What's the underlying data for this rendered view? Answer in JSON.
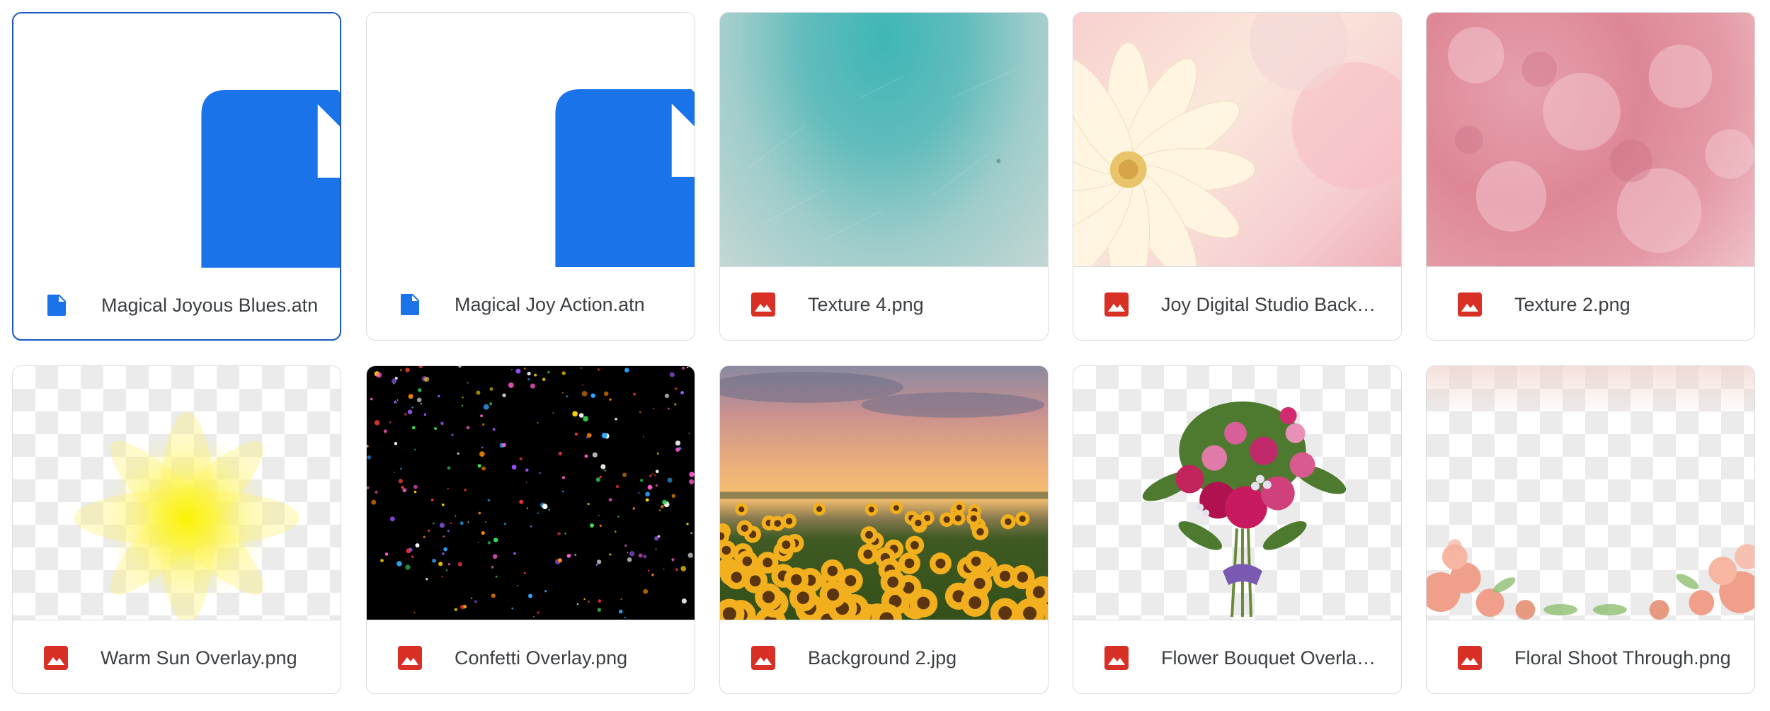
{
  "files": [
    {
      "name": "Magical Joyous Blues.atn",
      "type": "document",
      "icon": "document-icon",
      "selected": true
    },
    {
      "name": "Magical Joy Action.atn",
      "type": "document",
      "icon": "document-icon",
      "selected": false
    },
    {
      "name": "Texture 4.png",
      "type": "image",
      "icon": "image-icon",
      "preview": "teal-texture"
    },
    {
      "name": "Joy Digital Studio Backdrop.png",
      "type": "image",
      "icon": "image-icon",
      "preview": "cream-flower"
    },
    {
      "name": "Texture 2.png",
      "type": "image",
      "icon": "image-icon",
      "preview": "pink-texture"
    },
    {
      "name": "Warm Sun Overlay.png",
      "type": "image",
      "icon": "image-icon",
      "preview": "yellow-sun-overlay"
    },
    {
      "name": "Confetti Overlay.png",
      "type": "image",
      "icon": "image-icon",
      "preview": "confetti-on-black"
    },
    {
      "name": "Background 2.jpg",
      "type": "image",
      "icon": "image-icon",
      "preview": "sunflower-field-sunset"
    },
    {
      "name": "Flower Bouquet Overlay.png",
      "type": "image",
      "icon": "image-icon",
      "preview": "flower-bouquet"
    },
    {
      "name": "Floral Shoot Through.png",
      "type": "image",
      "icon": "image-icon",
      "preview": "floral-border"
    }
  ],
  "colors": {
    "doc_icon": "#1a73e8",
    "image_icon": "#d93025",
    "selected_border": "#1a56c4",
    "card_border": "#dadce0",
    "text": "#3c4043"
  }
}
